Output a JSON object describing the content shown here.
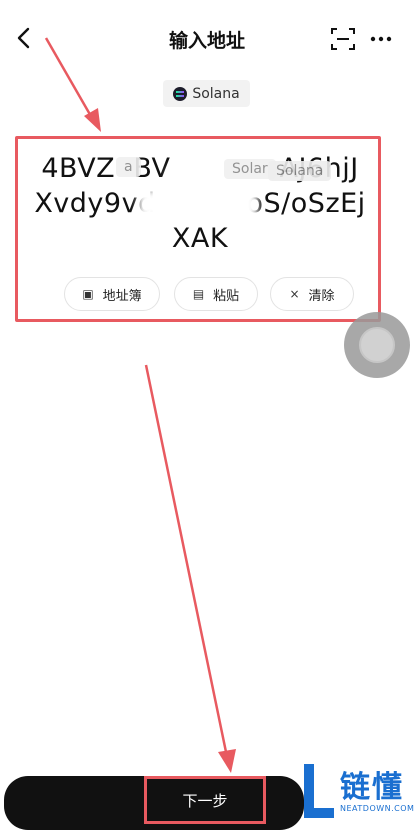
{
  "header": {
    "back_icon": "chevron-left-icon",
    "title": "输入地址",
    "scan_icon": "scan-icon",
    "more_icon": "more-icon"
  },
  "network": {
    "label": "Solana",
    "icon": "solana-icon"
  },
  "address": {
    "lines": "4BVZ  BV            AJ6hjJ\nXvdy9vd          oS/oSzEj\nXAK",
    "overlay_labels": [
      "a",
      "Solar",
      "Solana"
    ]
  },
  "actions": [
    {
      "icon": "address-book-icon",
      "icon_glyph": "▣",
      "label": "地址簿"
    },
    {
      "icon": "paste-icon",
      "icon_glyph": "▤",
      "label": "粘贴"
    },
    {
      "icon": "close-icon",
      "icon_glyph": "×",
      "label": "清除"
    }
  ],
  "footer": {
    "next_label": "下一步"
  },
  "watermark": {
    "brand": "链懂",
    "sub": "NEATDOWN.COM"
  },
  "colors": {
    "highlight": "#e85a60",
    "button": "#111111",
    "brand_blue": "#1a6fd0"
  }
}
